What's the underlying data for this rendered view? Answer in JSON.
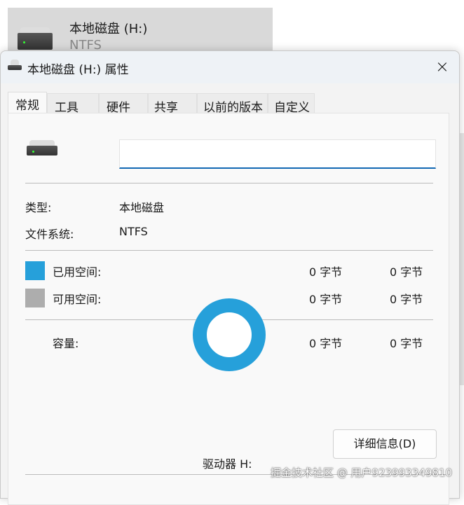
{
  "background_item": {
    "name": "本地磁盘 (H:)",
    "filesystem": "NTFS"
  },
  "dialog": {
    "title": "本地磁盘 (H:) 属性",
    "close_icon": "×"
  },
  "tabs": [
    "常规",
    "工具",
    "硬件",
    "共享",
    "以前的版本",
    "自定义"
  ],
  "general": {
    "name_value": "",
    "type_label": "类型:",
    "type_value": "本地磁盘",
    "fs_label": "文件系统:",
    "fs_value": "NTFS",
    "used_label": "已用空间:",
    "used_bytes": "0 字节",
    "used_size": "0 字节",
    "free_label": "可用空间:",
    "free_bytes": "0 字节",
    "free_size": "0 字节",
    "capacity_label": "容量:",
    "capacity_bytes": "0 字节",
    "capacity_size": "0 字节",
    "drive_label": "驱动器 H:",
    "details_button": "详细信息(D)",
    "used_color": "#26a0da",
    "free_color": "#adadad"
  },
  "watermark": "掘金技术社区 @ 用户923993349810"
}
